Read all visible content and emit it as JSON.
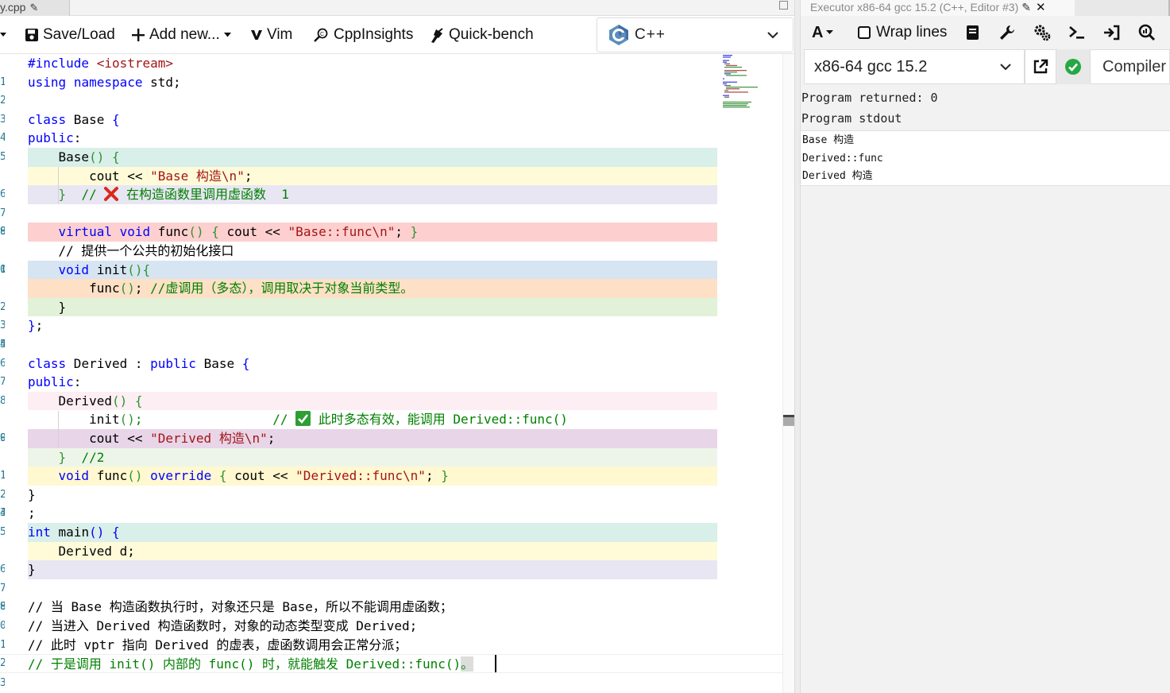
{
  "editor": {
    "tab_title": "y.cpp",
    "toolbar": {
      "save_label": "Save/Load",
      "add_label": "Add new...",
      "vim_label": "Vim",
      "cppinsights_label": "CppInsights",
      "quickbench_label": "Quick-bench"
    },
    "language": "C++",
    "line_numbers": [
      "1",
      "2",
      "3",
      "4",
      "5",
      "6",
      "7",
      "8",
      "9",
      "0",
      "1",
      "2",
      "3",
      "4",
      "5",
      "6",
      "7",
      "8",
      "9",
      "0",
      "1",
      "2",
      "3",
      "4",
      "5",
      "6",
      "7",
      "8",
      "9",
      "0",
      "1",
      "2",
      "3"
    ],
    "code": {
      "l1_a": "#include ",
      "l1_b": "<iostream>",
      "l2_a": "using",
      "l2_b": " ",
      "l2_c": "namespace",
      "l2_d": " std;",
      "l4_a": "class",
      "l4_b": " Base ",
      "l4_c": "{",
      "l5_a": "public",
      "l5_b": ":",
      "l6_a": "    Base",
      "l6_b": "()",
      "l6_c": " {",
      "l7_a": "        cout << ",
      "l7_b": "\"Base 构造\\n\"",
      "l7_c": ";",
      "l8_a": "    }",
      "l8_b": "  // ",
      "l8_c": " 在构造函数里调用虚函数  1",
      "l10_a": "    ",
      "l10_b": "virtual",
      "l10_c": " ",
      "l10_d": "void",
      "l10_e": " func",
      "l10_f": "()",
      "l10_g": " { ",
      "l10_h": "cout << ",
      "l10_i": "\"Base::func\\n\"",
      "l10_j": "; ",
      "l10_k": "}",
      "l11": "    // 提供一个公共的初始化接口",
      "l12_a": "    ",
      "l12_b": "void",
      "l12_c": " init",
      "l12_d": "(){",
      "l13_a": "        func",
      "l13_b": "()",
      "l13_c": "; ",
      "l13_d": "//虚调用（多态），调用取决于对象当前类型。",
      "l14": "    }",
      "l15_a": "}",
      "l15_b": ";",
      "l17_a": "class",
      "l17_b": " Derived : ",
      "l17_c": "public",
      "l17_d": " Base ",
      "l17_e": "{",
      "l18_a": "public",
      "l18_b": ":",
      "l19_a": "    Derived",
      "l19_b": "()",
      "l19_c": " {",
      "l20_a": "        init",
      "l20_b": "()",
      "l20_c": ";                 // ",
      "l20_d": " 此时多态有效，能调用 Derived::func()",
      "l21_a": "        cout << ",
      "l21_b": "\"Derived 构造\\n\"",
      "l21_c": ";",
      "l22_a": "    }",
      "l22_b": "  //2",
      "l23_a": "    ",
      "l23_b": "void",
      "l23_c": " func",
      "l23_d": "()",
      "l23_e": " ",
      "l23_f": "override",
      "l23_g": " { ",
      "l23_h": "cout << ",
      "l23_i": "\"Derived::func\\n\"",
      "l23_j": "; ",
      "l23_k": "}",
      "l24": "}",
      "l25": ";",
      "l26_a": "int",
      "l26_b": " main",
      "l26_c": "()",
      "l26_d": " {",
      "l27": "    Derived d;",
      "l28": "}",
      "l30": "// 当 Base 构造函数执行时，对象还只是 Base，所以不能调用虚函数；",
      "l31": "// 当进入 Derived 构造函数时，对象的动态类型变成 Derived;",
      "l32": "// 此时 vptr 指向 Derived 的虚表，虚函数调用会正常分派；",
      "l33_a": "// 于是调用 init() 内部的 func() 时，就能触发 Derived::func()",
      "l33_b": "。"
    }
  },
  "executor": {
    "tab_title": "Executor x86-64 gcc 15.2 (C++, Editor #3)",
    "toolbar": {
      "font_label": "A",
      "wrap_label": "Wrap lines"
    },
    "compiler_name": "x86-64 gcc 15.2",
    "compiler_label": "Compiler",
    "program_returned": "Program returned: 0",
    "program_stdout_label": "Program stdout",
    "stdout_lines": [
      "Base 构造",
      "Derived::func",
      "Derived 构造"
    ]
  },
  "colors": {
    "keyword": "#0000ff",
    "string": "#a31515",
    "comment": "#008000",
    "line_number": "#237893",
    "status_ok": "#28a745"
  },
  "icons": [
    "pencil-icon",
    "save-icon",
    "plus-icon",
    "vim-icon",
    "cppinsights-icon",
    "quickbench-icon",
    "cpp-logo-icon",
    "chevron-down-icon",
    "close-icon",
    "font-icon",
    "wrap-checkbox-icon",
    "book-icon",
    "wrench-icon",
    "gears-icon",
    "terminal-icon",
    "input-arrow-icon",
    "search-chart-icon",
    "external-link-icon",
    "check-circle-icon",
    "cross-mark-icon",
    "check-mark-icon",
    "maximize-icon"
  ]
}
